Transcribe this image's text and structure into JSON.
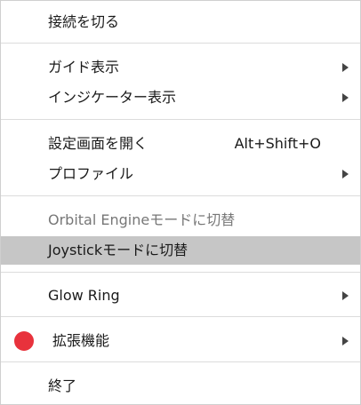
{
  "menu": {
    "disconnect": "接続を切る",
    "guide_display": "ガイド表示",
    "indicator_display": "インジケーター表示",
    "open_settings": "設定画面を開く",
    "open_settings_shortcut": "Alt+Shift+O",
    "profile": "プロファイル",
    "orbital_engine_mode": "Orbital Engineモードに切替",
    "joystick_mode": "Joystickモードに切替",
    "glow_ring": "Glow Ring",
    "extensions": "拡張機能",
    "exit": "終了"
  },
  "icons": {
    "submenu": "chevron-right-icon",
    "status": "red-dot-icon"
  },
  "colors": {
    "status_dot": "#e8323c",
    "highlight": "#c6c6c6",
    "disabled_text": "#777777"
  }
}
